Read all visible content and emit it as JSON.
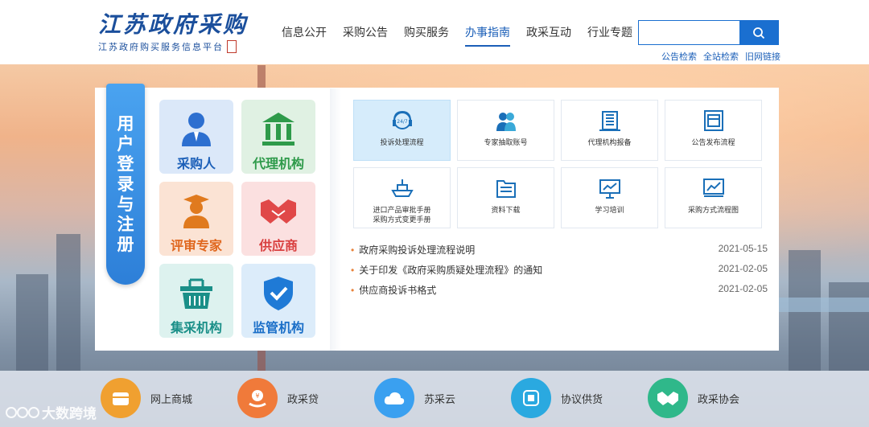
{
  "header": {
    "logo_title": "江苏政府采购",
    "logo_sub": "江苏政府购买服务信息平台",
    "nav": [
      "信息公开",
      "采购公告",
      "购买服务",
      "办事指南",
      "政采互动",
      "行业专题"
    ],
    "nav_active": "办事指南",
    "search_placeholder": "",
    "links": [
      "公告检索",
      "全站检索",
      "旧网链接"
    ]
  },
  "register": {
    "tab_chars": [
      "用",
      "户",
      "登",
      "录",
      "与",
      "注",
      "册"
    ],
    "tiles": [
      "采购人",
      "代理机构",
      "评审专家",
      "供应商",
      "集采机构",
      "监管机构"
    ]
  },
  "guides": [
    {
      "label": "投诉处理流程",
      "icon": "headset-24-7-icon",
      "selected": true
    },
    {
      "label": "专家抽取账号",
      "icon": "experts-icon",
      "selected": false
    },
    {
      "label": "代理机构报备",
      "icon": "building-icon",
      "selected": false
    },
    {
      "label": "公告发布流程",
      "icon": "document-icon",
      "selected": false
    },
    {
      "label": "进口产品审批手册",
      "label2": "采购方式变更手册",
      "icon": "ship-icon",
      "selected": false
    },
    {
      "label": "资料下载",
      "icon": "folder-icon",
      "selected": false
    },
    {
      "label": "学习培训",
      "icon": "presentation-icon",
      "selected": false
    },
    {
      "label": "采购方式流程图",
      "icon": "chart-board-icon",
      "selected": false
    }
  ],
  "news": [
    {
      "title": "政府采购投诉处理流程说明",
      "date": "2021-05-15"
    },
    {
      "title": "关于印发《政府采购质疑处理流程》的通知",
      "date": "2021-02-05"
    },
    {
      "title": "供应商投诉书格式",
      "date": "2021-02-05"
    }
  ],
  "quick_links": [
    {
      "label": "网上商城",
      "color": "#f0a030",
      "icon": "shop-icon"
    },
    {
      "label": "政采贷",
      "color": "#f07a3a",
      "icon": "loan-icon"
    },
    {
      "label": "苏采云",
      "color": "#3aa0f0",
      "icon": "cloud-icon"
    },
    {
      "label": "协议供货",
      "color": "#2aa9e0",
      "icon": "supply-icon"
    },
    {
      "label": "政采协会",
      "color": "#2fb88a",
      "icon": "handshake-icon"
    }
  ],
  "watermark": "大数跨境"
}
